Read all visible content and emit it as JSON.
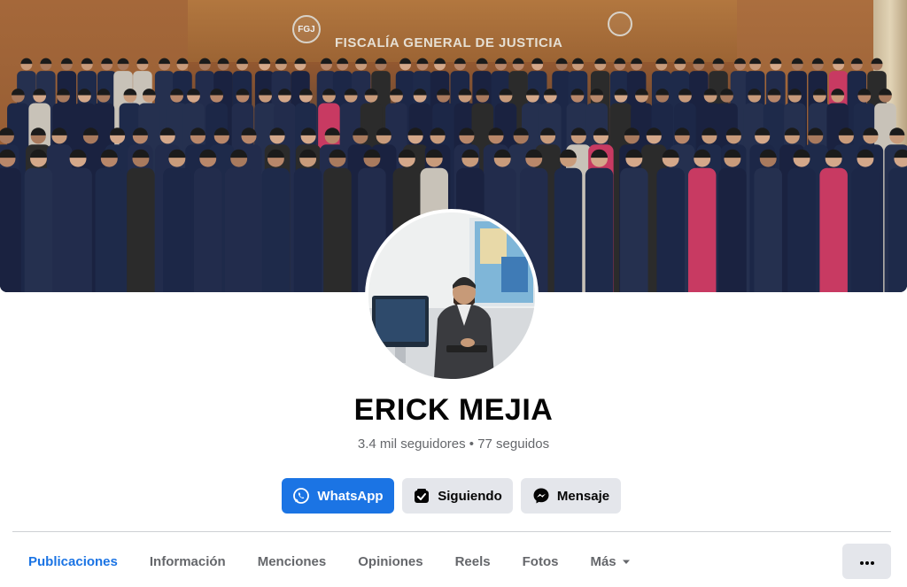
{
  "cover": {
    "wall_title": "FISCALÍA GENERAL DE JUSTICIA",
    "logo_text": "FGJ"
  },
  "profile": {
    "name": "ERICK MEJIA",
    "stats": "3.4 mil seguidores • 77 seguidos"
  },
  "actions": {
    "whatsapp": {
      "label": "WhatsApp",
      "icon": "whatsapp-icon"
    },
    "following": {
      "label": "Siguiendo",
      "icon": "following-icon"
    },
    "message": {
      "label": "Mensaje",
      "icon": "messenger-icon"
    }
  },
  "tabs": [
    {
      "label": "Publicaciones",
      "active": true
    },
    {
      "label": "Información"
    },
    {
      "label": "Menciones"
    },
    {
      "label": "Opiniones"
    },
    {
      "label": "Reels"
    },
    {
      "label": "Fotos"
    },
    {
      "label": "Más",
      "icon": "caret-down-icon"
    }
  ],
  "more_menu": {
    "icon": "more-dots-icon"
  },
  "colors": {
    "accent": "#1b74e4",
    "secondary_button": "#e4e6eb",
    "text_primary": "#050505",
    "text_secondary": "#65676b"
  }
}
